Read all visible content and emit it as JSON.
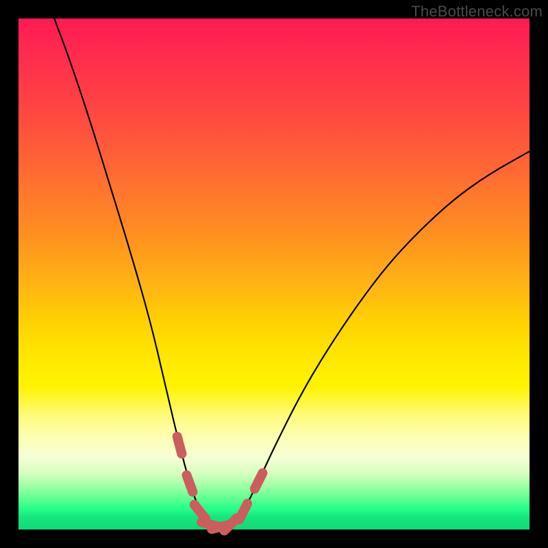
{
  "watermark": "TheBottleneck.com",
  "accent_marker_color": "#cd5c5c",
  "curve_color": "#000000",
  "chart_data": {
    "type": "line",
    "title": "",
    "xlabel": "",
    "ylabel": "",
    "xlim": [
      0,
      1
    ],
    "ylim": [
      0,
      1
    ],
    "series": [
      {
        "name": "bottleneck-curve",
        "x": [
          0.07,
          0.1,
          0.14,
          0.18,
          0.22,
          0.26,
          0.29,
          0.315,
          0.335,
          0.355,
          0.375,
          0.395,
          0.415,
          0.44,
          0.47,
          0.5,
          0.55,
          0.6,
          0.66,
          0.72,
          0.78,
          0.85,
          0.92,
          1.0
        ],
        "y": [
          1.0,
          0.92,
          0.8,
          0.67,
          0.54,
          0.4,
          0.27,
          0.165,
          0.09,
          0.035,
          0.01,
          0.005,
          0.01,
          0.035,
          0.095,
          0.16,
          0.26,
          0.345,
          0.435,
          0.515,
          0.58,
          0.645,
          0.695,
          0.74
        ]
      }
    ],
    "markers": {
      "name": "highlighted-bottom",
      "x": [
        0.315,
        0.335,
        0.355,
        0.375,
        0.395,
        0.415,
        0.44,
        0.47
      ],
      "y": [
        0.165,
        0.09,
        0.035,
        0.01,
        0.005,
        0.01,
        0.035,
        0.095
      ]
    }
  }
}
